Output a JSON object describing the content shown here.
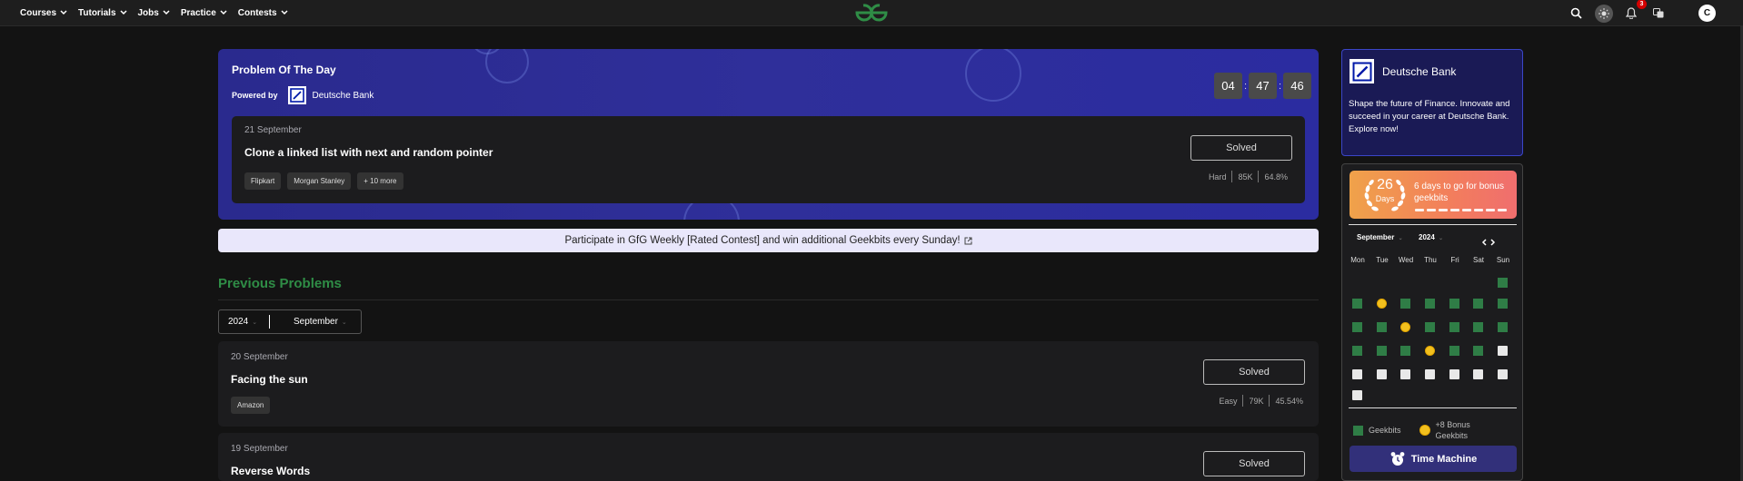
{
  "nav": {
    "items": [
      {
        "label": "Courses"
      },
      {
        "label": "Tutorials"
      },
      {
        "label": "Jobs"
      },
      {
        "label": "Practice"
      },
      {
        "label": "Contests"
      }
    ],
    "notification_count": "3",
    "avatar_letter": "C"
  },
  "potd": {
    "title": "Problem Of The Day",
    "powered_by": "Powered by",
    "sponsor": "Deutsche Bank",
    "timer": {
      "hours": "04",
      "minutes": "47",
      "seconds": "46",
      "separator": ":"
    },
    "problem": {
      "date": "21 September",
      "title": "Clone a linked list with next and random pointer",
      "tags": [
        "Flipkart",
        "Morgan Stanley",
        "+ 10 more"
      ],
      "status": "Solved",
      "difficulty": "Hard",
      "submissions": "85K",
      "accuracy": "64.8%"
    }
  },
  "banner": {
    "text": "Participate in GfG Weekly [Rated Contest] and win additional Geekbits every Sunday!"
  },
  "previous": {
    "title": "Previous Problems",
    "year": "2024",
    "month": "September",
    "problems": [
      {
        "date": "20 September",
        "title": "Facing the sun",
        "tags": [
          "Amazon"
        ],
        "status": "Solved",
        "difficulty": "Easy",
        "submissions": "79K",
        "accuracy": "45.54%"
      },
      {
        "date": "19 September",
        "title": "Reverse Words",
        "status": "Solved"
      }
    ]
  },
  "promo": {
    "name": "Deutsche Bank",
    "text": "Shape the future of Finance. Innovate and succeed in your career at Deutsche Bank. Explore now!"
  },
  "streak": {
    "count": "26",
    "unit": "Days",
    "message": "6 days to go for bonus geekbits",
    "days_to_go": 6
  },
  "calendar": {
    "month": "September",
    "year": "2024",
    "weekdays": [
      "Mon",
      "Tue",
      "Wed",
      "Thu",
      "Fri",
      "Sat",
      "Sun"
    ],
    "legend_geekbits": "Geekbits",
    "legend_bonus": "+8 Bonus Geekbits",
    "time_machine": "Time Machine"
  },
  "colors": {
    "brand_green": "#2f8d46",
    "potd_bg": "#2d2e96",
    "streak_gradient_start": "#f0a24a",
    "streak_gradient_end": "#f06e6e"
  }
}
